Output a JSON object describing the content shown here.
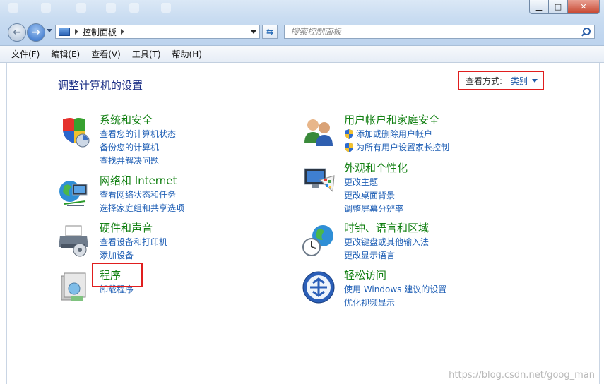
{
  "window": {
    "buttons": {
      "minimize": "▁",
      "maximize": "□",
      "close": "✕"
    }
  },
  "navigation": {
    "address_crumb": "控制面板",
    "search_placeholder": "搜索控制面板"
  },
  "menu": [
    "文件(F)",
    "编辑(E)",
    "查看(V)",
    "工具(T)",
    "帮助(H)"
  ],
  "page": {
    "title": "调整计算机的设置",
    "view_by_label": "查看方式:",
    "view_by_value": "类别"
  },
  "categories": [
    {
      "title": "系统和安全",
      "icon": "shield-icon",
      "links": [
        "查看您的计算机状态",
        "备份您的计算机",
        "查找并解决问题"
      ]
    },
    {
      "title": "网络和 Internet",
      "icon": "network-globe-icon",
      "links": [
        "查看网络状态和任务",
        "选择家庭组和共享选项"
      ]
    },
    {
      "title": "硬件和声音",
      "icon": "printer-icon",
      "links": [
        "查看设备和打印机",
        "添加设备"
      ]
    },
    {
      "title": "程序",
      "icon": "programs-icon",
      "links": [
        "卸载程序"
      ]
    },
    {
      "title": "用户帐户和家庭安全",
      "icon": "users-icon",
      "links": [
        "添加或删除用户帐户",
        "为所有用户设置家长控制"
      ]
    },
    {
      "title": "外观和个性化",
      "icon": "monitor-palette-icon",
      "links": [
        "更改主题",
        "更改桌面背景",
        "调整屏幕分辨率"
      ]
    },
    {
      "title": "时钟、语言和区域",
      "icon": "clock-globe-icon",
      "links": [
        "更改键盘或其他输入法",
        "更改显示语言"
      ]
    },
    {
      "title": "轻松访问",
      "icon": "ease-of-access-icon",
      "links": [
        "使用 Windows 建议的设置",
        "优化视频显示"
      ]
    }
  ],
  "watermark": "https://blog.csdn.net/goog_man"
}
